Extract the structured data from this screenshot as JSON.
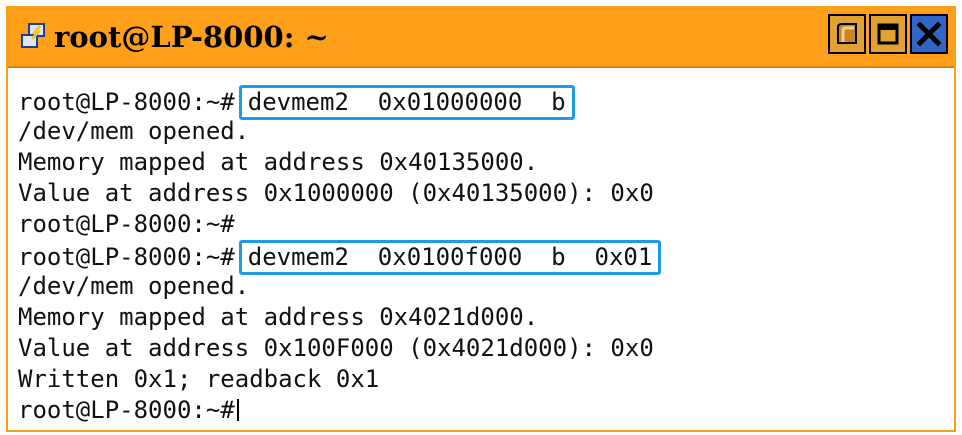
{
  "window": {
    "title": "root@LP-8000: ~",
    "icons": {
      "app": "putty-terminal-icon",
      "minimize": "minimize-icon",
      "maximize": "maximize-icon",
      "close": "close-icon"
    },
    "colors": {
      "titlebar": "#ff9f1a",
      "highlight": "#1e9be6"
    }
  },
  "terminal": {
    "prompt": "root@LP-8000:~#",
    "lines": [
      {
        "type": "command",
        "prompt": "root@LP-8000:~#",
        "command": "devmem2  0x01000000  b"
      },
      {
        "type": "output",
        "text": "/dev/mem opened."
      },
      {
        "type": "output",
        "text": "Memory mapped at address 0x40135000."
      },
      {
        "type": "output",
        "text": "Value at address 0x1000000 (0x40135000): 0x0"
      },
      {
        "type": "prompt",
        "prompt": "root@LP-8000:~#"
      },
      {
        "type": "command",
        "prompt": "root@LP-8000:~#",
        "command": "devmem2  0x0100f000  b  0x01"
      },
      {
        "type": "output",
        "text": "/dev/mem opened."
      },
      {
        "type": "output",
        "text": "Memory mapped at address 0x4021d000."
      },
      {
        "type": "output",
        "text": "Value at address 0x100F000 (0x4021d000): 0x0"
      },
      {
        "type": "output",
        "text": "Written 0x1; readback 0x1"
      },
      {
        "type": "prompt",
        "prompt": "root@LP-8000:~#"
      }
    ]
  }
}
